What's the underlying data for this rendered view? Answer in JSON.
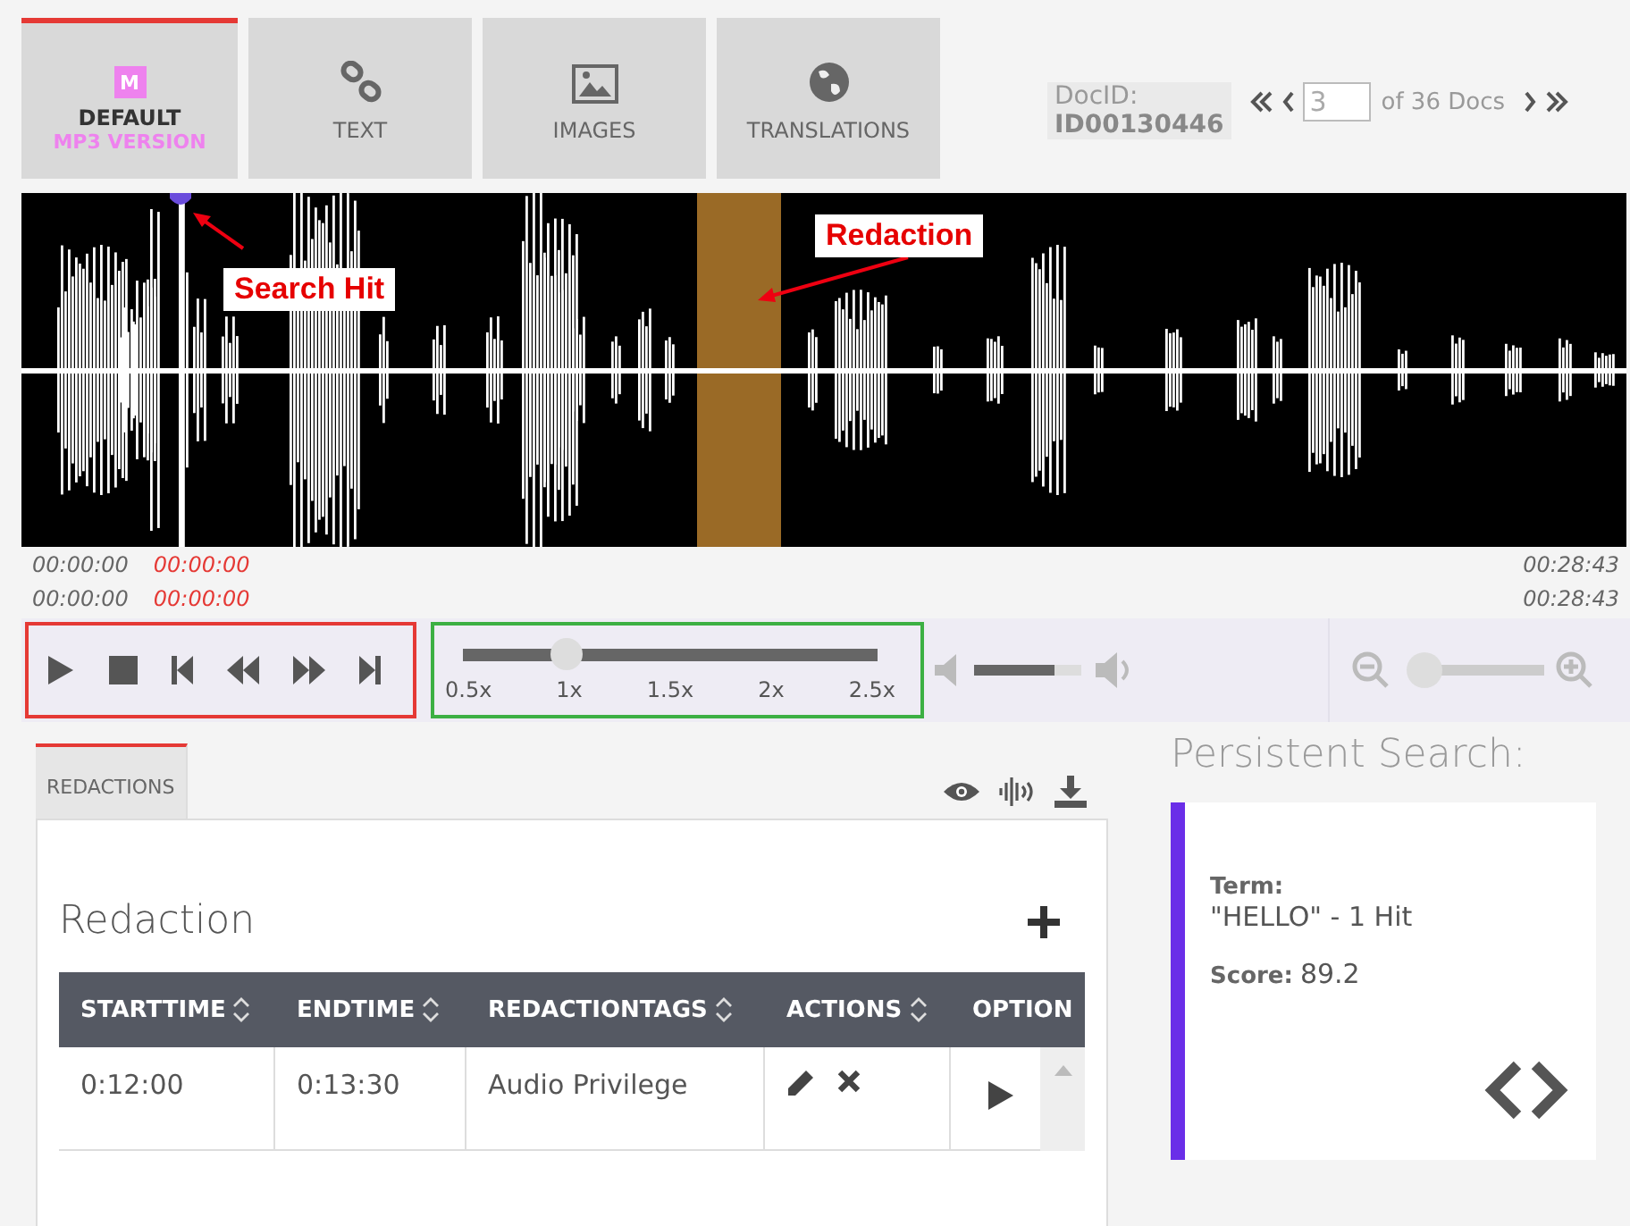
{
  "tabs": [
    {
      "kind": "mp3",
      "badge": "M",
      "label": "DEFAULT",
      "sublabel": "MP3 VERSION",
      "selected": true
    },
    {
      "kind": "link",
      "label": "TEXT",
      "selected": false
    },
    {
      "kind": "image",
      "label": "IMAGES",
      "selected": false
    },
    {
      "kind": "globe",
      "label": "TRANSLATIONS",
      "selected": false
    }
  ],
  "doc_nav": {
    "label": "DocID:",
    "doc_id": "ID00130446",
    "page": "3",
    "of_text": "of 36 Docs"
  },
  "waveform": {
    "annotations": [
      {
        "kind": "search_hit",
        "label": "Search Hit"
      },
      {
        "kind": "redaction",
        "label": "Redaction"
      }
    ]
  },
  "timestamps": [
    {
      "start": "00:00:00",
      "current": "00:00:00",
      "end": "00:28:43"
    },
    {
      "start": "00:00:00",
      "current": "00:00:00",
      "end": "00:28:43"
    }
  ],
  "speed": {
    "level": 0.25,
    "ticks": [
      "0.5x",
      "1x",
      "1.5x",
      "2x",
      "2.5x"
    ]
  },
  "volume": {
    "level": 0.75
  },
  "zoom": {
    "level": 0.05
  },
  "panel": {
    "tab": {
      "label": "REDACTIONS",
      "selected": true
    },
    "heading": "Redaction",
    "columns": [
      "STARTTIME",
      "ENDTIME",
      "REDACTIONTAGS",
      "ACTIONS",
      "OPTION"
    ],
    "rows": [
      {
        "starttime": "0:12:00",
        "endtime": "0:13:30",
        "tags": "Audio Privilege"
      }
    ]
  },
  "persistent_search": {
    "title": "Persistent Search:",
    "term_label": "Term:",
    "term": "\"HELLO\" - 1 Hit",
    "score_label": "Score:",
    "score": "89.2"
  }
}
